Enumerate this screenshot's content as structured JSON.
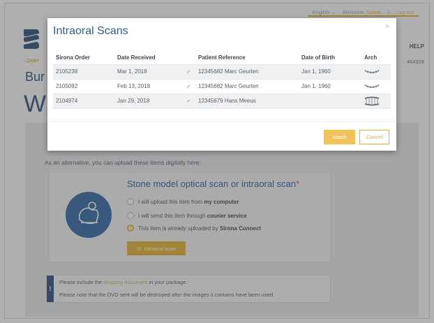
{
  "topbar": {
    "language": "English",
    "welcome": "Welcome,",
    "user": "Name",
    "separator": "|",
    "logout": "Log out"
  },
  "nav": {
    "help": "HELP",
    "phone": "464338"
  },
  "breadcrumb": "‹ Order",
  "background": {
    "title1": "Bur",
    "title2": "W",
    "alternative_text": "As an alternative, you can upload these items digitally here:",
    "card_title": "Stone model optical scan or intraoral scan",
    "required_mark": "*",
    "options": [
      {
        "prefix": "I will upload this item from ",
        "bold": "my computer",
        "selected": false
      },
      {
        "prefix": "I will send this item through ",
        "bold": "courier service",
        "selected": false
      },
      {
        "prefix": "This item is already uploaded by ",
        "bold": "Sirona Connect",
        "selected": true
      }
    ],
    "scan_button": "Intraoral scan",
    "notice": {
      "icon": "!",
      "line1_prefix": "Please include the ",
      "line1_link": "shipping document",
      "line1_suffix": " in your package.",
      "line2": "Please note that the DVD sent will be destroyed after the images it contains have been used."
    }
  },
  "modal": {
    "title": "Intraoral Scans",
    "close": "×",
    "columns": [
      "Sirona Order",
      "Date Received",
      "",
      "Patient Reference",
      "Date of Birth",
      "Arch"
    ],
    "rows": [
      {
        "order": "2105238",
        "date": "Mar 1, 2018",
        "sex": "♂",
        "patient": "12345682 Marc Geurten",
        "dob": "Jan 1, 1960",
        "arch": "lower-arch-icon",
        "selected": true
      },
      {
        "order": "2105092",
        "date": "Feb 13, 2018",
        "sex": "♂",
        "patient": "12345682 Marc Geurten",
        "dob": "Jan 1, 1960",
        "arch": "lower-arch-icon",
        "selected": false
      },
      {
        "order": "2104974",
        "date": "Jan 29, 2018",
        "sex": "♂",
        "patient": "12345679 Hans Meeus",
        "dob": "",
        "arch": "full-arch-icon",
        "selected": true
      }
    ],
    "attach": "Attach",
    "cancel": "Cancel"
  },
  "colors": {
    "accent": "#e5b22f",
    "brand_blue": "#2d5e98",
    "navy": "#2d4f7c"
  }
}
